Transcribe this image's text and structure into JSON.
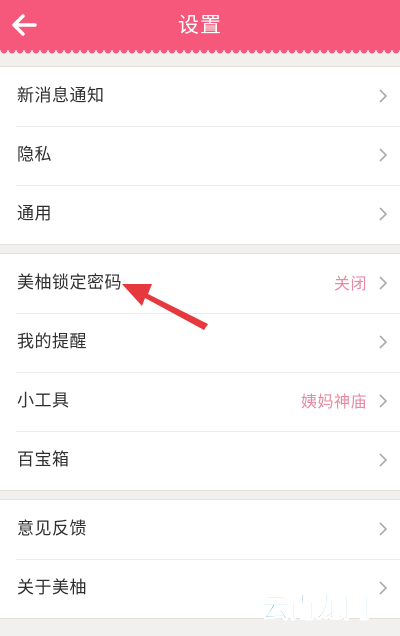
{
  "header": {
    "title": "设置"
  },
  "colors": {
    "header_bg": "#f5587b",
    "accent_text": "#e88aa3",
    "annotation_arrow": "#e5393d",
    "watermark": "#1f9ad6"
  },
  "groups": [
    {
      "items": [
        {
          "label": "新消息通知",
          "value": "",
          "icon": "chevron-right-icon"
        },
        {
          "label": "隐私",
          "value": "",
          "icon": "chevron-right-icon"
        },
        {
          "label": "通用",
          "value": "",
          "icon": "chevron-right-icon"
        }
      ]
    },
    {
      "items": [
        {
          "label": "美柚锁定密码",
          "value": "关闭",
          "icon": "chevron-right-icon"
        },
        {
          "label": "我的提醒",
          "value": "",
          "icon": "chevron-right-icon"
        },
        {
          "label": "小工具",
          "value": "姨妈神庙",
          "icon": "chevron-right-icon"
        },
        {
          "label": "百宝箱",
          "value": "",
          "icon": "chevron-right-icon"
        }
      ]
    },
    {
      "items": [
        {
          "label": "意见反馈",
          "value": "",
          "icon": "chevron-right-icon"
        },
        {
          "label": "关于美柚",
          "value": "",
          "icon": "chevron-right-icon"
        }
      ]
    }
  ],
  "watermark": {
    "text": "云南龙网"
  }
}
